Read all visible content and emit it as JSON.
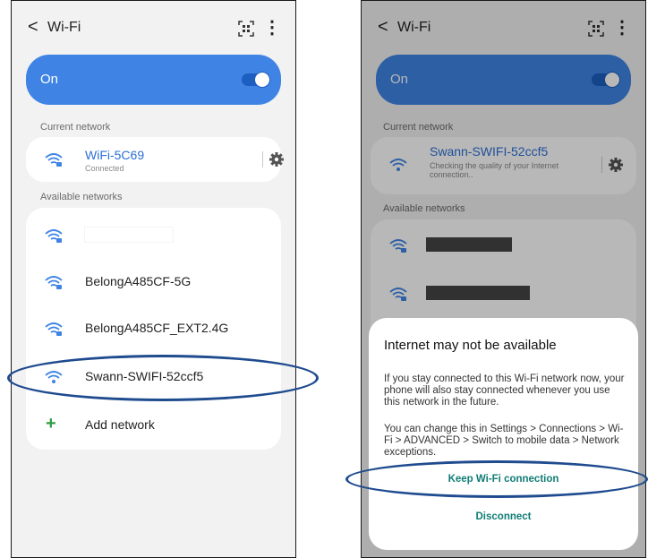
{
  "left": {
    "header": {
      "back": "<",
      "title": "Wi-Fi",
      "more": "⋮"
    },
    "on_label": "On",
    "current_section": "Current network",
    "current": {
      "name": "WiFi-5C69",
      "status": "Connected"
    },
    "available_section": "Available networks",
    "networks": [
      "BelongA485CF-5G",
      "BelongA485CF_EXT2.4G",
      "Swann-SWIFI-52ccf5"
    ],
    "add_network": "Add network"
  },
  "right": {
    "header": {
      "back": "<",
      "title": "Wi-Fi",
      "more": "⋮"
    },
    "on_label": "On",
    "current_section": "Current network",
    "current": {
      "name": "Swann-SWIFI-52ccf5",
      "status": "Checking the quality of your Internet connection.."
    },
    "available_section": "Available networks",
    "dialog": {
      "title": "Internet may not be available",
      "body1": "If you stay connected to this Wi-Fi network now, your phone will also stay connected whenever you use this network in the future.",
      "body2": "You can change this in Settings > Connections > Wi-Fi > ADVANCED > Switch to mobile data > Network exceptions.",
      "keep": "Keep Wi-Fi connection",
      "disconnect": "Disconnect"
    }
  },
  "colors": {
    "accent": "#3f84e5",
    "link": "#2b6fd6",
    "teal": "#0f7d76",
    "ellipse": "#1f4b8f",
    "plus": "#2f9e44"
  },
  "icons": [
    "wifi-lock-icon",
    "wifi-icon",
    "qr-scan-icon",
    "gear-icon",
    "more-vert-icon",
    "plus-icon",
    "back-chevron-icon"
  ]
}
